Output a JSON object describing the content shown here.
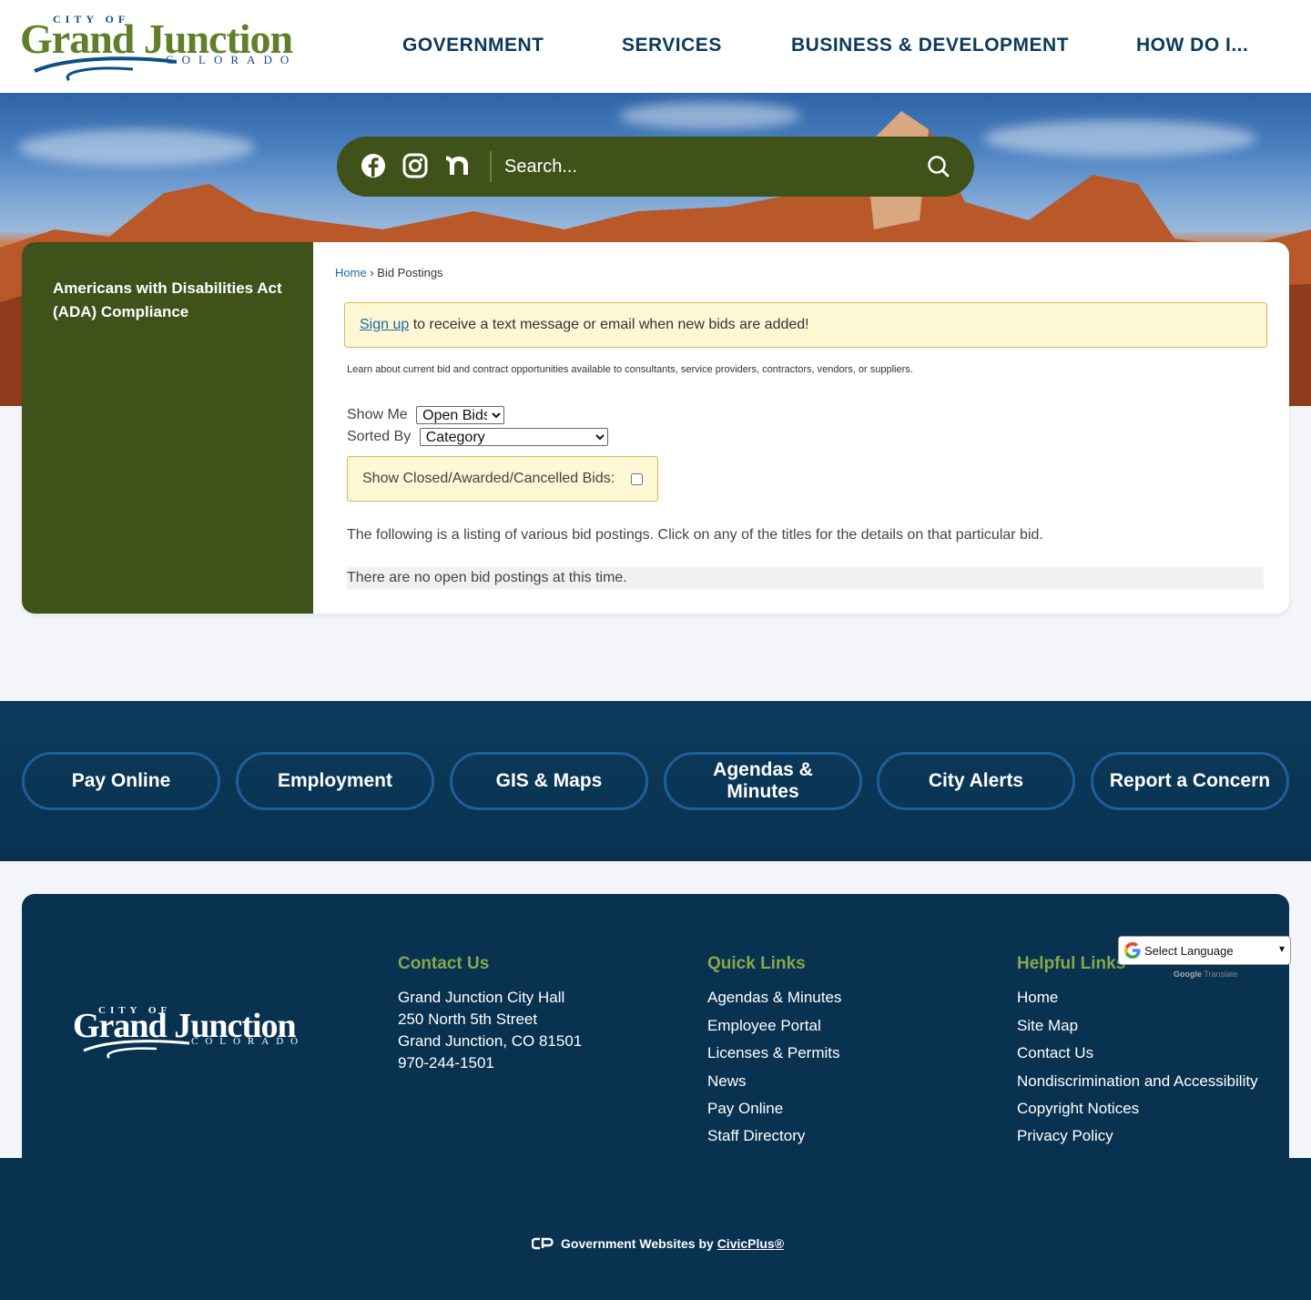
{
  "logo": {
    "city_of": "CITY OF",
    "name": "Grand Junction",
    "state": "COLORADO"
  },
  "nav": {
    "items": [
      {
        "label": "GOVERNMENT"
      },
      {
        "label": "SERVICES"
      },
      {
        "label": "BUSINESS & DEVELOPMENT"
      },
      {
        "label": "HOW DO I..."
      }
    ]
  },
  "search": {
    "placeholder": "Search...",
    "social": [
      "facebook-icon",
      "instagram-icon",
      "nextdoor-icon"
    ]
  },
  "sidebar": {
    "items": [
      {
        "label": "Americans with Disabilities Act (ADA) Compliance"
      }
    ]
  },
  "breadcrumb": {
    "home": "Home",
    "separator": "›",
    "current": "Bid Postings"
  },
  "alert": {
    "link": "Sign up",
    "text": " to receive a text message or email when new bids are added!"
  },
  "description": "Learn about current bid and contract opportunities available to consultants, service providers, contractors, vendors, or suppliers.",
  "filters": {
    "show_label": "Show Me",
    "show_value": "Open Bids",
    "sort_label": "Sorted By",
    "sort_value": "Category",
    "closed_label": "Show Closed/Awarded/Cancelled Bids:"
  },
  "listing_text": "The following is a listing of various bid postings. Click on any of the titles for the details on that particular bid.",
  "no_bids": "There are no open bid postings at this time.",
  "quick_buttons": [
    {
      "label": "Pay Online"
    },
    {
      "label": "Employment"
    },
    {
      "label": "GIS & Maps"
    },
    {
      "label": "Agendas & Minutes"
    },
    {
      "label": "City Alerts"
    },
    {
      "label": "Report a Concern"
    }
  ],
  "footer": {
    "contact": {
      "title": "Contact Us",
      "line1": "Grand Junction City Hall",
      "line2": "250 North 5th Street",
      "line3": "Grand Junction, CO 81501",
      "phone": "970-244-1501"
    },
    "quick_links": {
      "title": "Quick Links",
      "items": [
        {
          "label": "Agendas & Minutes"
        },
        {
          "label": "Employee Portal"
        },
        {
          "label": "Licenses & Permits"
        },
        {
          "label": "News"
        },
        {
          "label": "Pay Online"
        },
        {
          "label": "Staff Directory"
        }
      ]
    },
    "helpful_links": {
      "title": "Helpful Links",
      "items": [
        {
          "label": "Home"
        },
        {
          "label": "Site Map"
        },
        {
          "label": "Contact Us"
        },
        {
          "label": "Nondiscrimination and Accessibility"
        },
        {
          "label": "Copyright Notices"
        },
        {
          "label": "Privacy Policy"
        }
      ]
    },
    "translate": {
      "label": "Select Language",
      "powered_google": "Google",
      "powered_translate": "Translate"
    },
    "credit_text": "Government Websites by ",
    "credit_link": "CivicPlus®"
  },
  "colors": {
    "brand_green": "#3f521a",
    "brand_navy": "#083250",
    "link_blue": "#1f6aa6",
    "heading_green": "#86a84a"
  }
}
